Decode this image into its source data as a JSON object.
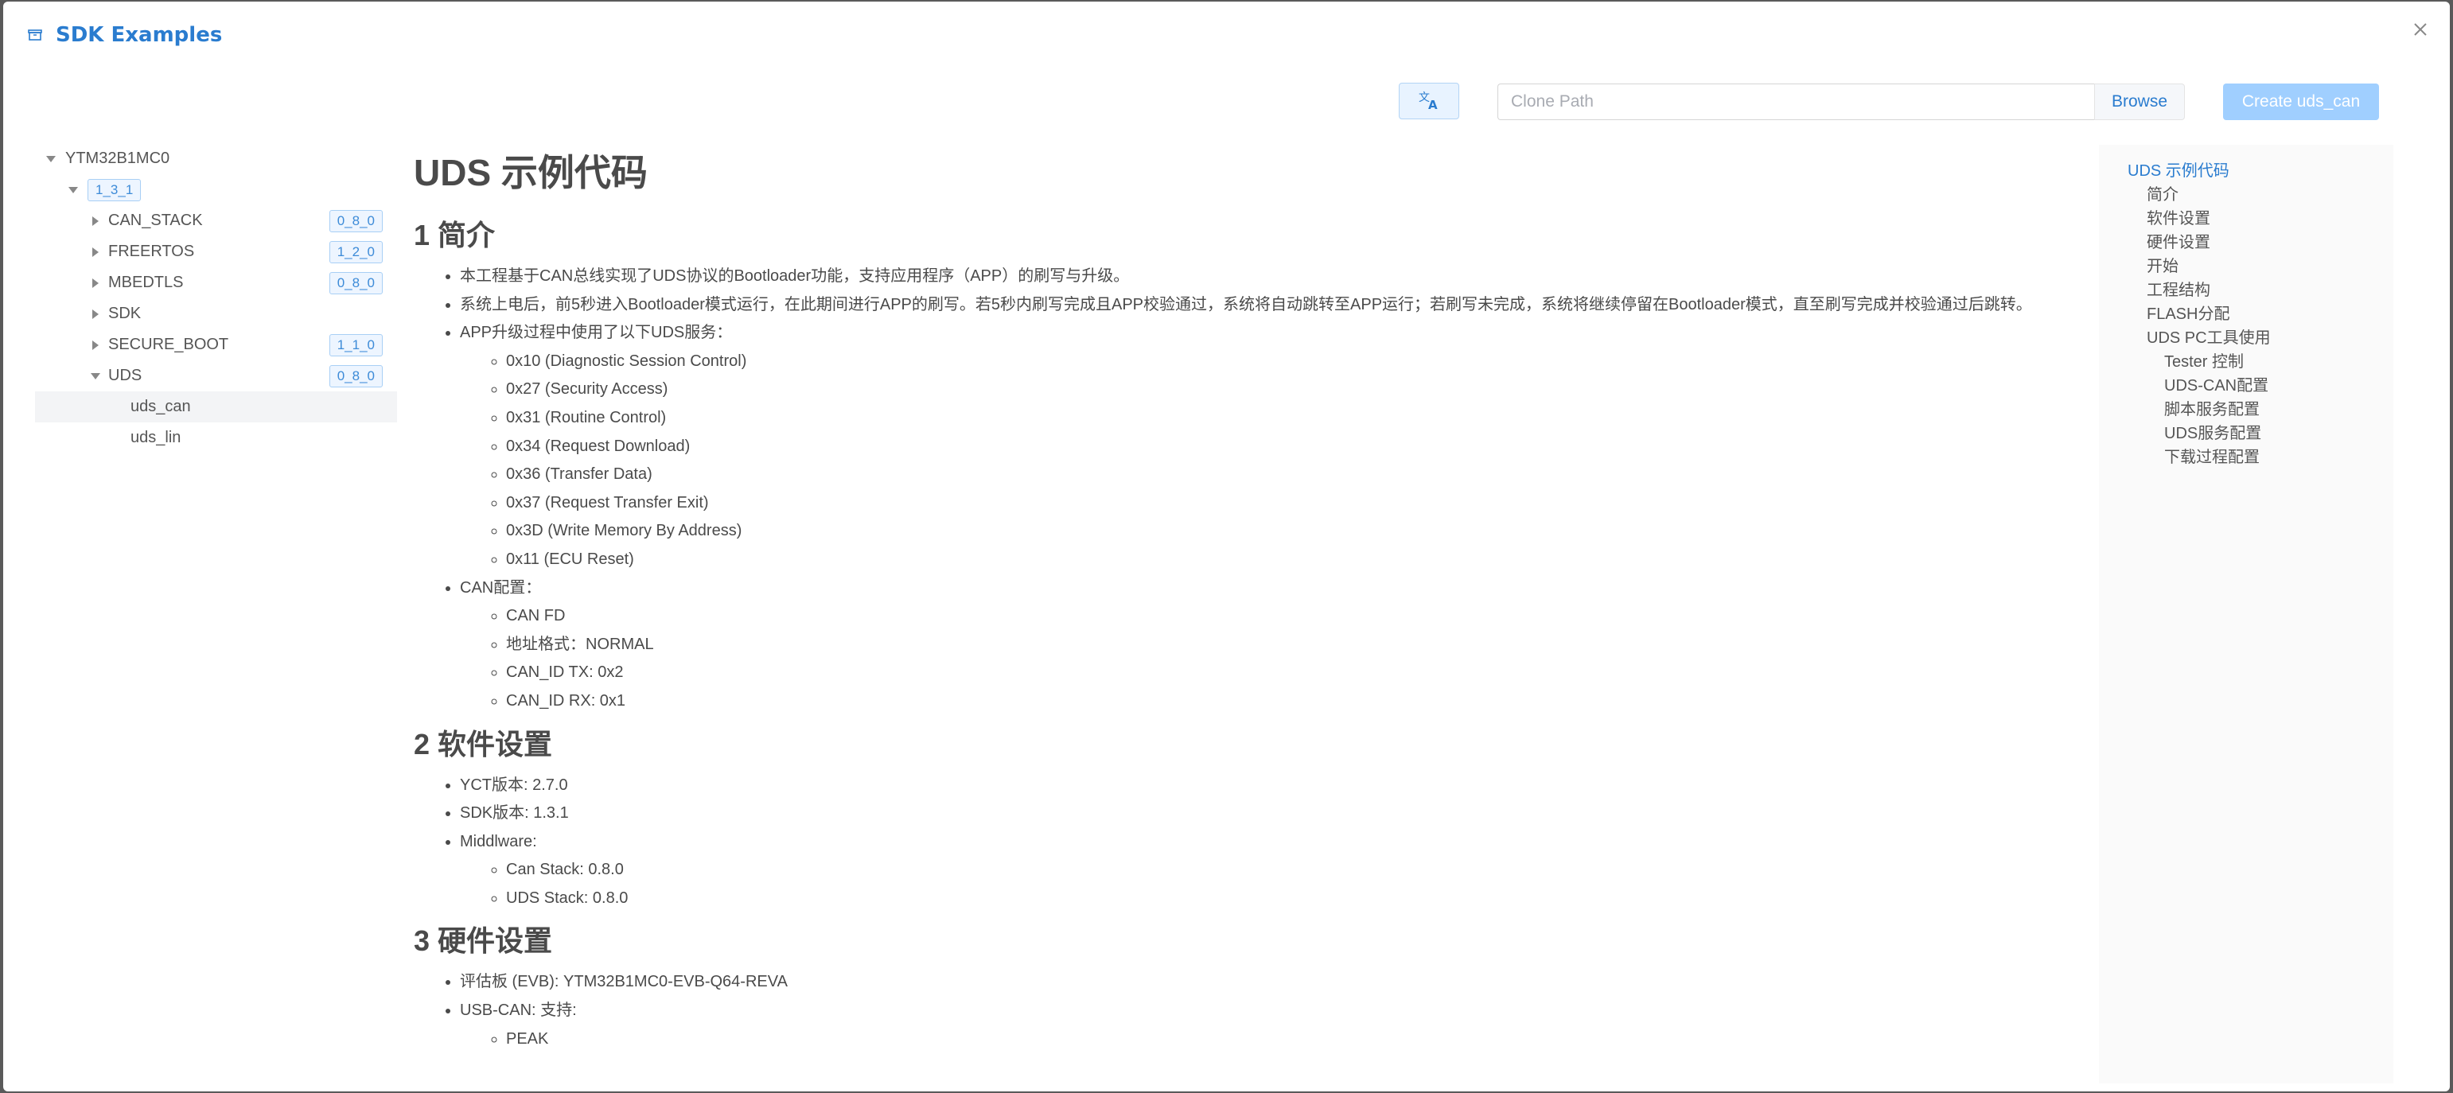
{
  "dialog": {
    "title": "SDK Examples",
    "icon": "archive-icon",
    "close_icon": "close-icon"
  },
  "toolbar": {
    "translate_icon": "translate-icon",
    "clone_path_placeholder": "Clone Path",
    "clone_path_value": "",
    "browse_label": "Browse",
    "create_label": "Create uds_can"
  },
  "tree": {
    "root": "YTM32B1MC0",
    "version": "1_3_1",
    "items": [
      {
        "label": "CAN_STACK",
        "tag": "0_8_0",
        "expanded": false
      },
      {
        "label": "FREERTOS",
        "tag": "1_2_0",
        "expanded": false
      },
      {
        "label": "MBEDTLS",
        "tag": "0_8_0",
        "expanded": false
      },
      {
        "label": "SDK",
        "tag": "",
        "expanded": false
      },
      {
        "label": "SECURE_BOOT",
        "tag": "1_1_0",
        "expanded": false
      },
      {
        "label": "UDS",
        "tag": "0_8_0",
        "expanded": true
      }
    ],
    "children": [
      {
        "label": "uds_can",
        "selected": true
      },
      {
        "label": "uds_lin",
        "selected": false
      }
    ]
  },
  "doc": {
    "title": "UDS 示例代码",
    "s1_heading": "1 简介",
    "s1_items": [
      "本工程基于CAN总线实现了UDS协议的Bootloader功能，支持应用程序（APP）的刷写与升级。",
      "系统上电后，前5秒进入Bootloader模式运行，在此期间进行APP的刷写。若5秒内刷写完成且APP校验通过，系统将自动跳转至APP运行；若刷写未完成，系统将继续停留在Bootloader模式，直至刷写完成并校验通过后跳转。",
      "APP升级过程中使用了以下UDS服务："
    ],
    "s1_services": [
      "0x10 (Diagnostic Session Control)",
      "0x27 (Security Access)",
      "0x31 (Routine Control)",
      "0x34 (Request Download)",
      "0x36 (Transfer Data)",
      "0x37 (Request Transfer Exit)",
      "0x3D (Write Memory By Address)",
      "0x11 (ECU Reset)"
    ],
    "s1_can_label": "CAN配置：",
    "s1_can_items": [
      "CAN FD",
      "地址格式：NORMAL",
      "CAN_ID TX: 0x2",
      "CAN_ID RX: 0x1"
    ],
    "s2_heading": "2 软件设置",
    "s2_items": [
      "YCT版本: 2.7.0",
      "SDK版本: 1.3.1",
      "Middlware:"
    ],
    "s2_middleware": [
      "Can Stack: 0.8.0",
      "UDS Stack: 0.8.0"
    ],
    "s3_heading": "3 硬件设置",
    "s3_items": [
      "评估板 (EVB): YTM32B1MC0-EVB-Q64-REVA",
      "USB-CAN: 支持:"
    ],
    "s3_usbcan": [
      "PEAK"
    ]
  },
  "toc": {
    "items": [
      {
        "label": "UDS 示例代码",
        "level": 0
      },
      {
        "label": "简介",
        "level": 1
      },
      {
        "label": "软件设置",
        "level": 1
      },
      {
        "label": "硬件设置",
        "level": 1
      },
      {
        "label": "开始",
        "level": 1
      },
      {
        "label": "工程结构",
        "level": 1
      },
      {
        "label": "FLASH分配",
        "level": 1
      },
      {
        "label": "UDS PC工具使用",
        "level": 1
      },
      {
        "label": "Tester 控制",
        "level": 2
      },
      {
        "label": "UDS-CAN配置",
        "level": 2
      },
      {
        "label": "脚本服务配置",
        "level": 2
      },
      {
        "label": "UDS服务配置",
        "level": 2
      },
      {
        "label": "下载过程配置",
        "level": 2
      }
    ]
  },
  "colors": {
    "accent": "#2a7ccf",
    "create_button_disabled": "#a0cfff",
    "tag_border": "#a8cff5"
  }
}
